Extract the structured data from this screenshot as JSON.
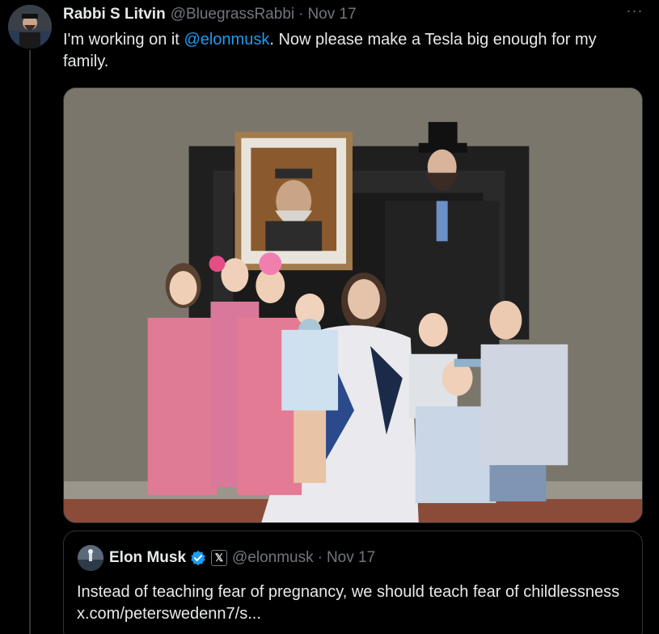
{
  "tweet": {
    "author_name": "Rabbi S Litvin",
    "author_handle": "@BluegrassRabbi",
    "separator": "·",
    "date": "Nov 17",
    "more_label": "···",
    "text_before": "I'm working on it ",
    "mention": "@elonmusk",
    "text_after": ". Now please make a Tesla big enough for my family.",
    "avatar_icon": "profile-photo",
    "media_alt": "Family photo"
  },
  "quote": {
    "author_name": "Elon Musk",
    "author_handle": "@elonmusk",
    "separator": "·",
    "date": "Nov 17",
    "x_badge": "𝕏",
    "verified_icon": "verified-badge-icon",
    "text": "Instead of teaching fear of pregnancy, we should teach fear of childlessness x.com/peterswedenn7/s..."
  },
  "colors": {
    "background": "#000000",
    "text_primary": "#e7e9ea",
    "text_secondary": "#71767b",
    "link": "#1d9bf0",
    "border": "#2f3336",
    "verified": "#1d9bf0"
  }
}
